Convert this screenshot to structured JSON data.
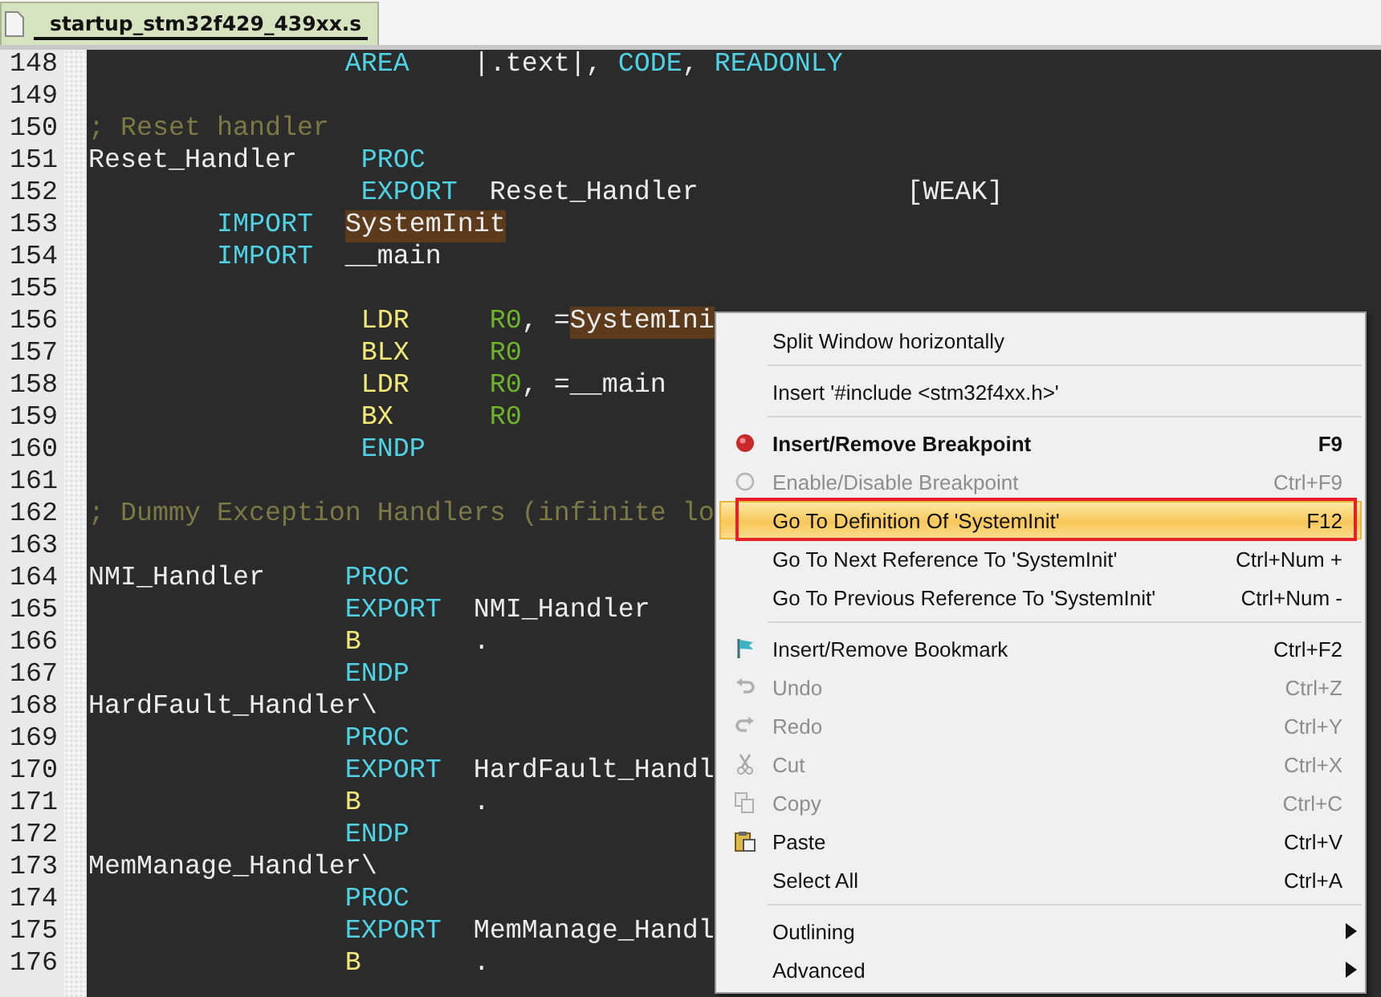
{
  "tab": {
    "label": "startup_stm32f429_439xx.s",
    "selected": true
  },
  "code_lines": [
    {
      "number": "148",
      "tokens": [
        {
          "kind": "keyword",
          "text": "                AREA"
        },
        {
          "kind": "plain",
          "text": "    |.text|, "
        },
        {
          "kind": "keyword",
          "text": "CODE"
        },
        {
          "kind": "plain",
          "text": ", "
        },
        {
          "kind": "keyword",
          "text": "READONLY"
        }
      ]
    },
    {
      "number": "149"
    },
    {
      "number": "150",
      "tokens": [
        {
          "kind": "comment",
          "text": "; Reset handler"
        }
      ]
    },
    {
      "number": "151",
      "tokens": [
        {
          "kind": "plain",
          "text": "Reset_Handler"
        },
        {
          "kind": "keyword",
          "text": "    PROC"
        }
      ]
    },
    {
      "number": "152",
      "tokens": [
        {
          "kind": "keyword",
          "text": "                 EXPORT"
        },
        {
          "kind": "plain",
          "text": "  Reset_Handler             [WEAK]"
        }
      ]
    },
    {
      "number": "153",
      "tokens": [
        {
          "kind": "keyword",
          "text": "        IMPORT  "
        },
        {
          "kind": "match",
          "text": "SystemInit"
        }
      ]
    },
    {
      "number": "154",
      "tokens": [
        {
          "kind": "keyword",
          "text": "        IMPORT"
        },
        {
          "kind": "plain",
          "text": "  __main"
        }
      ]
    },
    {
      "number": "155"
    },
    {
      "number": "156",
      "tokens": [
        {
          "kind": "instruction",
          "text": "                 LDR"
        },
        {
          "kind": "register",
          "text": "     R0"
        },
        {
          "kind": "plain",
          "text": ", ="
        },
        {
          "kind": "match",
          "text": "SystemIni"
        }
      ]
    },
    {
      "number": "157",
      "tokens": [
        {
          "kind": "instruction",
          "text": "                 BLX"
        },
        {
          "kind": "register",
          "text": "     R0"
        }
      ]
    },
    {
      "number": "158",
      "tokens": [
        {
          "kind": "instruction",
          "text": "                 LDR"
        },
        {
          "kind": "register",
          "text": "     R0"
        },
        {
          "kind": "plain",
          "text": ", =__main"
        }
      ]
    },
    {
      "number": "159",
      "tokens": [
        {
          "kind": "instruction",
          "text": "                 BX"
        },
        {
          "kind": "register",
          "text": "      R0"
        }
      ]
    },
    {
      "number": "160",
      "tokens": [
        {
          "kind": "keyword",
          "text": "                 ENDP"
        }
      ]
    },
    {
      "number": "161"
    },
    {
      "number": "162",
      "tokens": [
        {
          "kind": "comment",
          "text": "; Dummy Exception Handlers (infinite lo"
        }
      ]
    },
    {
      "number": "163"
    },
    {
      "number": "164",
      "tokens": [
        {
          "kind": "plain",
          "text": "NMI_Handler"
        },
        {
          "kind": "keyword",
          "text": "     PROC"
        }
      ]
    },
    {
      "number": "165",
      "tokens": [
        {
          "kind": "keyword",
          "text": "                EXPORT"
        },
        {
          "kind": "plain",
          "text": "  NMI_Handler"
        }
      ]
    },
    {
      "number": "166",
      "tokens": [
        {
          "kind": "instruction",
          "text": "                B"
        },
        {
          "kind": "plain",
          "text": "       ."
        }
      ]
    },
    {
      "number": "167",
      "tokens": [
        {
          "kind": "keyword",
          "text": "                ENDP"
        }
      ]
    },
    {
      "number": "168",
      "tokens": [
        {
          "kind": "plain",
          "text": "HardFault_Handler\\"
        }
      ]
    },
    {
      "number": "169",
      "tokens": [
        {
          "kind": "keyword",
          "text": "                PROC"
        }
      ]
    },
    {
      "number": "170",
      "tokens": [
        {
          "kind": "keyword",
          "text": "                EXPORT"
        },
        {
          "kind": "plain",
          "text": "  HardFault_Handl"
        }
      ]
    },
    {
      "number": "171",
      "tokens": [
        {
          "kind": "instruction",
          "text": "                B"
        },
        {
          "kind": "plain",
          "text": "       ."
        }
      ]
    },
    {
      "number": "172",
      "tokens": [
        {
          "kind": "keyword",
          "text": "                ENDP"
        }
      ]
    },
    {
      "number": "173",
      "tokens": [
        {
          "kind": "plain",
          "text": "MemManage_Handler\\"
        }
      ]
    },
    {
      "number": "174",
      "tokens": [
        {
          "kind": "keyword",
          "text": "                PROC"
        }
      ]
    },
    {
      "number": "175",
      "tokens": [
        {
          "kind": "keyword",
          "text": "                EXPORT"
        },
        {
          "kind": "plain",
          "text": "  MemManage_Handl"
        }
      ]
    },
    {
      "number": "176",
      "tokens": [
        {
          "kind": "instruction",
          "text": "                B"
        },
        {
          "kind": "plain",
          "text": "       ."
        }
      ]
    }
  ],
  "context_menu": {
    "items": [
      {
        "kind": "item",
        "label": "Split Window horizontally",
        "disabled": false,
        "selected": false,
        "default": false
      },
      {
        "kind": "separator"
      },
      {
        "kind": "item",
        "label": "Insert '#include <stm32f4xx.h>'",
        "disabled": false,
        "selected": false,
        "default": false
      },
      {
        "kind": "separator"
      },
      {
        "kind": "item",
        "label": "Insert/Remove Breakpoint",
        "shortcut": "F9",
        "disabled": false,
        "selected": false,
        "default": true
      },
      {
        "kind": "item",
        "label": "Enable/Disable Breakpoint",
        "shortcut": "Ctrl+F9",
        "disabled": true,
        "selected": false,
        "default": false
      },
      {
        "kind": "item",
        "label": "Go To Definition Of 'SystemInit'",
        "shortcut": "F12",
        "disabled": false,
        "selected": true,
        "default": false
      },
      {
        "kind": "item",
        "label": "Go To Next Reference To 'SystemInit'",
        "shortcut": "Ctrl+Num +",
        "disabled": false,
        "selected": false,
        "default": false
      },
      {
        "kind": "item",
        "label": "Go To Previous Reference To 'SystemInit'",
        "shortcut": "Ctrl+Num -",
        "disabled": false,
        "selected": false,
        "default": false
      },
      {
        "kind": "separator"
      },
      {
        "kind": "item",
        "label": "Insert/Remove Bookmark",
        "shortcut": "Ctrl+F2",
        "disabled": false,
        "selected": false,
        "default": false
      },
      {
        "kind": "item",
        "label": "Undo",
        "shortcut": "Ctrl+Z",
        "disabled": true,
        "selected": false,
        "default": false
      },
      {
        "kind": "item",
        "label": "Redo",
        "shortcut": "Ctrl+Y",
        "disabled": true,
        "selected": false,
        "default": false
      },
      {
        "kind": "item",
        "label": "Cut",
        "shortcut": "Ctrl+X",
        "disabled": true,
        "selected": false,
        "default": false
      },
      {
        "kind": "item",
        "label": "Copy",
        "shortcut": "Ctrl+C",
        "disabled": true,
        "selected": false,
        "default": false
      },
      {
        "kind": "item",
        "label": "Paste",
        "shortcut": "Ctrl+V",
        "disabled": false,
        "selected": false,
        "default": false
      },
      {
        "kind": "item",
        "label": "Select All",
        "shortcut": "Ctrl+A",
        "disabled": false,
        "selected": false,
        "default": false
      },
      {
        "kind": "separator"
      },
      {
        "kind": "submenu",
        "label": "Outlining",
        "disabled": false,
        "selected": false,
        "default": false
      },
      {
        "kind": "submenu",
        "label": "Advanced",
        "disabled": false,
        "selected": false,
        "default": false
      }
    ]
  }
}
